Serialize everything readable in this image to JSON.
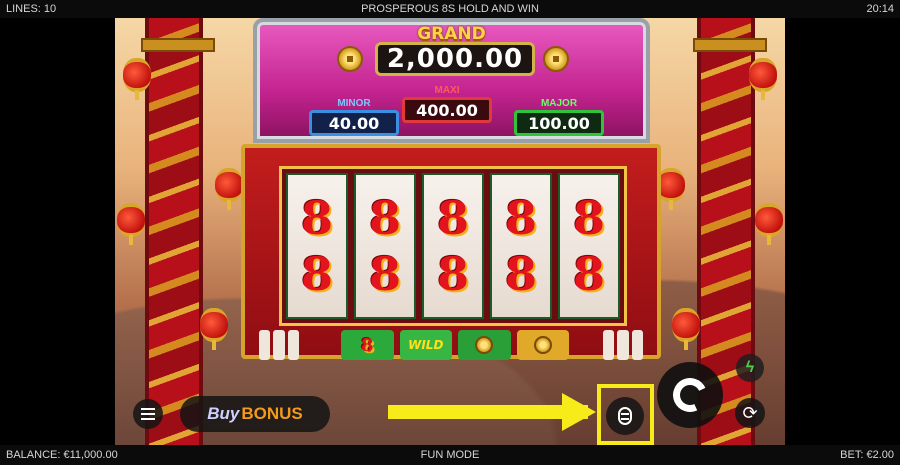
{
  "topbar": {
    "lines": "LINES: 10",
    "title": "PROSPEROUS 8S HOLD AND WIN",
    "clock": "20:14"
  },
  "bottombar": {
    "balance": "BALANCE: €11,000.00",
    "mode": "FUN MODE",
    "bet": "BET: €2.00"
  },
  "jackpots": {
    "grand_label": "GRAND",
    "grand_value": "2,000.00",
    "minor_label": "MINOR",
    "minor_value": "40.00",
    "maxi_label": "MAXI",
    "maxi_value": "400.00",
    "major_label": "MAJOR",
    "major_value": "100.00"
  },
  "reels": {
    "symbol": "8",
    "columns": [
      [
        "8",
        "8"
      ],
      [
        "8",
        "8"
      ],
      [
        "8",
        "8"
      ],
      [
        "8",
        "8"
      ],
      [
        "8",
        "8"
      ]
    ]
  },
  "bonus_row": {
    "wild_label": "WILD"
  },
  "controls": {
    "buy": "Buy",
    "bonus": "BONUS",
    "cycle_glyph": "⟳",
    "turbo_glyph": "ϟ"
  },
  "colors": {
    "highlight": "#f7ec1a",
    "grand_gold": "#ffd24a",
    "minor_blue": "#3a8fe0",
    "maxi_red": "#e23a3a",
    "major_green": "#2fc43a"
  },
  "icons": [
    "menu-icon",
    "autoplay-stack-icon",
    "spin-arrow-icon",
    "turbo-icon",
    "cycle-icon",
    "coin-icon"
  ]
}
